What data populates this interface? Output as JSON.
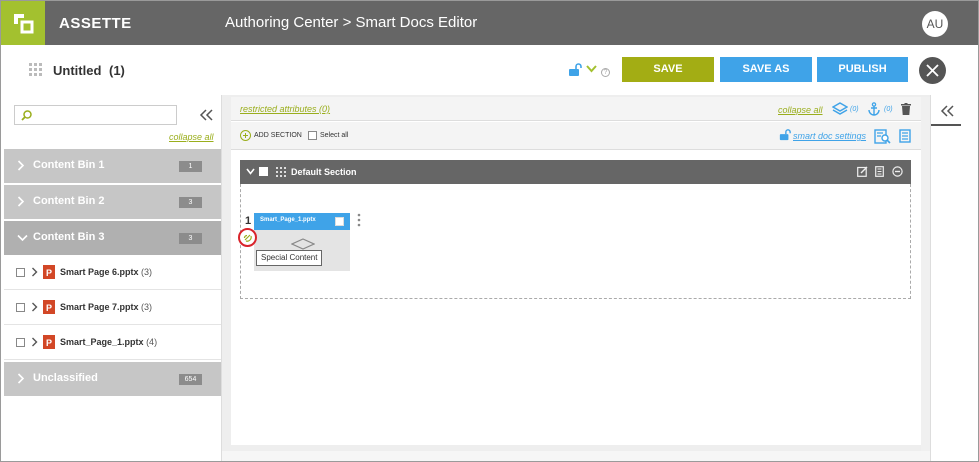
{
  "header": {
    "brand": "ASSETTE",
    "breadcrumb": "Authoring Center > Smart Docs Editor",
    "avatar_initials": "AU",
    "brand_color": "#a3c12f",
    "bar_color": "#666666"
  },
  "titlebar": {
    "doc_title": "Untitled",
    "doc_count": "(1)",
    "save_label": "SAVE",
    "save_as_label": "SAVE AS",
    "publish_label": "PUBLISH",
    "save_color": "#a3ad14",
    "action_color": "#3fa3e8"
  },
  "sidebar": {
    "search_placeholder": "",
    "collapse_all": "collapse all",
    "bins": [
      {
        "label": "Content Bin 1",
        "count": "1"
      },
      {
        "label": "Content Bin 2",
        "count": "3"
      },
      {
        "label": "Content Bin 3",
        "count": "3"
      },
      {
        "label": "Unclassified",
        "count": "654"
      }
    ],
    "bin3_items": [
      {
        "name": "Smart Page 6.pptx",
        "count": "(3)"
      },
      {
        "name": "Smart Page 7.pptx",
        "count": "(3)"
      },
      {
        "name": "Smart_Page_1.pptx",
        "count": "(4)"
      }
    ]
  },
  "editor": {
    "restricted_attributes": "restricted attributes (0)",
    "collapse_all": "collapse all",
    "layers_count": "(0)",
    "anchor_count": "(0)",
    "add_section": "ADD SECTION",
    "select_all": "Select all",
    "smart_doc_settings": "smart doc settings",
    "section_title": "Default Section",
    "page_number": "1",
    "page_name": "Smart_Page_1.pptx",
    "tooltip": "Special Content"
  }
}
